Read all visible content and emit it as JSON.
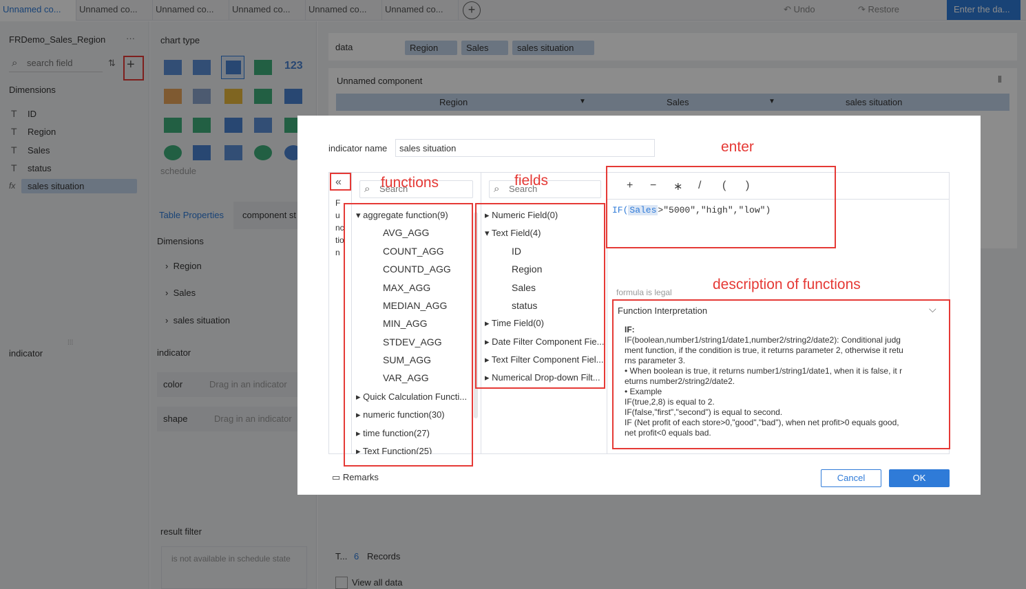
{
  "tabs": [
    "Unnamed co...",
    "Unnamed co...",
    "Unnamed co...",
    "Unnamed co...",
    "Unnamed co...",
    "Unnamed co..."
  ],
  "toolbar": {
    "add_tab": "+",
    "undo": "Undo",
    "restore": "Restore",
    "enter_data": "Enter the da..."
  },
  "left_panel": {
    "dataset": "FRDemo_Sales_Region",
    "more": "···",
    "search_placeholder": "search field",
    "add": "+",
    "dimensions_title": "Dimensions",
    "fields": [
      "ID",
      "Region",
      "Sales",
      "status",
      "sales situation"
    ],
    "indicator_title": "indicator"
  },
  "chart_panel": {
    "title": "chart type",
    "schedule_label": "schedule",
    "tabs": [
      "Table Properties",
      "component st"
    ],
    "dimensions_title": "Dimensions",
    "dimension_items": [
      "Region",
      "Sales",
      "sales situation"
    ],
    "indicator_title": "indicator",
    "color_label": "color",
    "shape_label": "shape",
    "drag_hint": "Drag in an indicator",
    "result_filter_title": "result filter",
    "result_filter_hint": "is not available in schedule state"
  },
  "main": {
    "data_label": "data",
    "data_pills": [
      "Region",
      "Sales",
      "sales situation"
    ],
    "component_title": "Unnamed component",
    "columns": [
      "Region",
      "Sales",
      "sales situation"
    ],
    "footer_prefix": "T...",
    "record_count": "6",
    "records_label": "Records",
    "view_all": "View all data"
  },
  "dialog": {
    "indicator_name_label": "indicator name",
    "indicator_name_value": "sales situation",
    "collapse_icon": "«",
    "collapsed_text": "F u nc tio n",
    "functions_search_placeholder": "Search",
    "fields_search_placeholder": "Search",
    "function_groups": [
      {
        "label": "aggregate function(9)",
        "expanded": true,
        "items": [
          "AVG_AGG",
          "COUNT_AGG",
          "COUNTD_AGG",
          "MAX_AGG",
          "MEDIAN_AGG",
          "MIN_AGG",
          "STDEV_AGG",
          "SUM_AGG",
          "VAR_AGG"
        ]
      },
      {
        "label": "Quick Calculation Functi...",
        "expanded": false
      },
      {
        "label": "numeric function(30)",
        "expanded": false
      },
      {
        "label": "time function(27)",
        "expanded": false
      },
      {
        "label": "Text Function(25)",
        "expanded": false
      }
    ],
    "field_groups": [
      {
        "label": "Numeric Field(0)",
        "expanded": false
      },
      {
        "label": "Text Field(4)",
        "expanded": true,
        "items": [
          "ID",
          "Region",
          "Sales",
          "status"
        ]
      },
      {
        "label": "Time Field(0)",
        "expanded": false
      },
      {
        "label": "Date Filter Component Fie...",
        "expanded": false
      },
      {
        "label": "Text Filter Component Fiel...",
        "expanded": false
      },
      {
        "label": "Numerical Drop-down Filt...",
        "expanded": false
      }
    ],
    "operators": [
      "+",
      "−",
      "∗",
      "/",
      "(",
      ")"
    ],
    "formula": {
      "fn": "IF(",
      "field": "Sales",
      "rest": ">\"5000\",\"high\",\"low\")"
    },
    "formula_status": "formula is legal",
    "interpretation_title": "Function Interpretation",
    "interpretation_lines": [
      "IF:",
      "IF(boolean,number1/string1/date1,number2/string2/date2): Conditional judg",
      "ment function, if the condition is true, it returns parameter 2, otherwise it retu",
      "rns parameter 3.",
      "• When boolean is true, it returns number1/string1/date1, when it is false, it r",
      "eturns number2/string2/date2.",
      "• Example",
      "IF(true,2,8) is equal to 2.",
      "IF(false,\"first\",\"second\") is equal to second.",
      "IF (Net profit of each store>0,\"good\",\"bad\"), when net profit>0 equals good,",
      "net profit<0 equals bad."
    ],
    "remarks": "Remarks",
    "cancel": "Cancel",
    "ok": "OK"
  },
  "annotations": {
    "functions": "functions",
    "fields": "fields",
    "enter": "enter",
    "description": "description of functions"
  },
  "colors": {
    "accent": "#2f7bd8",
    "annotation": "#e53935",
    "pill": "#c2d3ea"
  }
}
